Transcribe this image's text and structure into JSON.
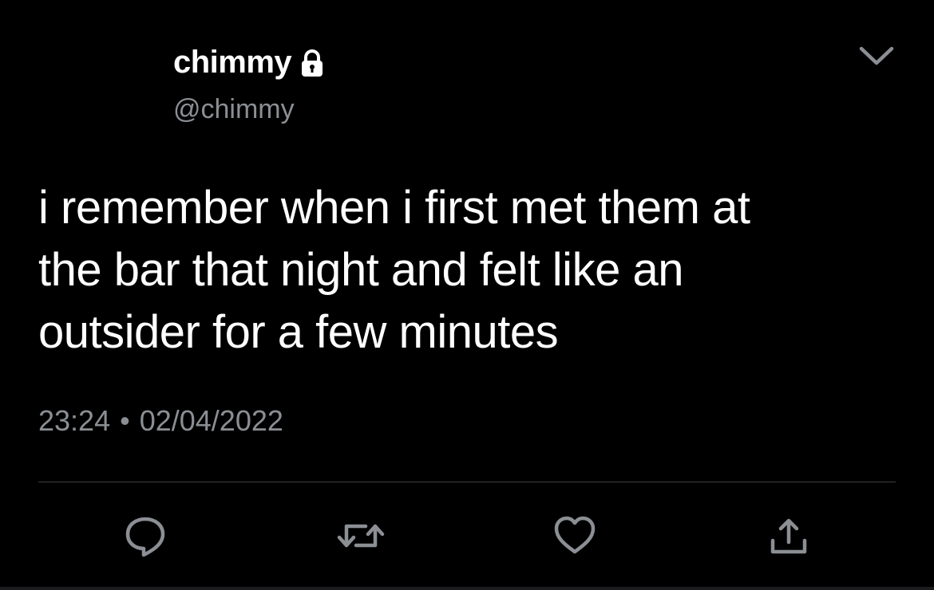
{
  "user": {
    "display_name": "chimmy",
    "handle": "@chimmy",
    "protected_icon": "lock-icon"
  },
  "tweet": {
    "lines": [
      "i remember when i first met them at",
      "the bar that night and felt like an",
      "outsider for a few minutes"
    ],
    "time": "23:24",
    "separator": "•",
    "date": "02/04/2022"
  },
  "actions": [
    {
      "name": "reply",
      "icon": "speech-bubble-icon"
    },
    {
      "name": "retweet",
      "icon": "retweet-arrows-icon"
    },
    {
      "name": "like",
      "icon": "heart-icon"
    },
    {
      "name": "share",
      "icon": "share-upload-icon"
    }
  ],
  "colors": {
    "background": "#000000",
    "primary_text": "#ffffff",
    "secondary_text": "#8b8f94",
    "icon_gray": "#8b8f94",
    "divider": "#3b3f43"
  }
}
